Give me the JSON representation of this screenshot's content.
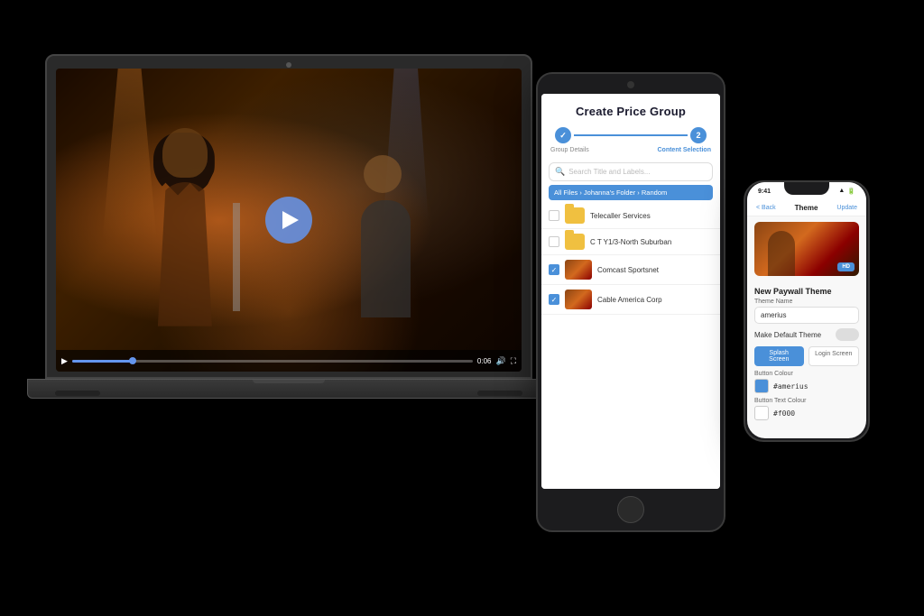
{
  "scene": {
    "bg": "#000000"
  },
  "laptop": {
    "screen": {
      "play_button_label": "▶",
      "time": "0:06",
      "controls": {
        "play": "▶",
        "volume": "🔊",
        "fullscreen": "⛶"
      }
    }
  },
  "tablet": {
    "title": "Create Price Group",
    "steps": [
      {
        "id": 1,
        "label": "Group Details",
        "state": "completed"
      },
      {
        "id": 2,
        "label": "Content Selection",
        "state": "active"
      }
    ],
    "search_placeholder": "Search Title and Labels...",
    "breadcrumb": "All Files › Johanna's Folder › Random",
    "files": [
      {
        "id": 1,
        "name": "Telecaller Services",
        "type": "folder",
        "checked": false
      },
      {
        "id": 2,
        "name": "C T Y1/3-North Suburban",
        "type": "folder",
        "checked": false
      },
      {
        "id": 3,
        "name": "Comcast Sportsnet",
        "type": "video",
        "checked": true
      },
      {
        "id": 4,
        "name": "Cable America Corp",
        "type": "video",
        "checked": true
      }
    ]
  },
  "phone": {
    "status_bar": {
      "time": "9:41",
      "icons": "●●●"
    },
    "nav": {
      "back": "< Back",
      "title": "Theme",
      "action": "Update"
    },
    "video_badge": "HD",
    "section_title": "New Paywall Theme",
    "form": {
      "theme_name_label": "Theme Name",
      "theme_name_placeholder": "amerius",
      "default_theme_label": "Make Default Theme",
      "splash_label": "Splash Screen",
      "login_label": "Login Screen",
      "button_colour_label": "Button Colour",
      "button_colour_value": "#amerius",
      "button_text_label": "Button Text Colour",
      "button_text_value": "#f000"
    }
  }
}
